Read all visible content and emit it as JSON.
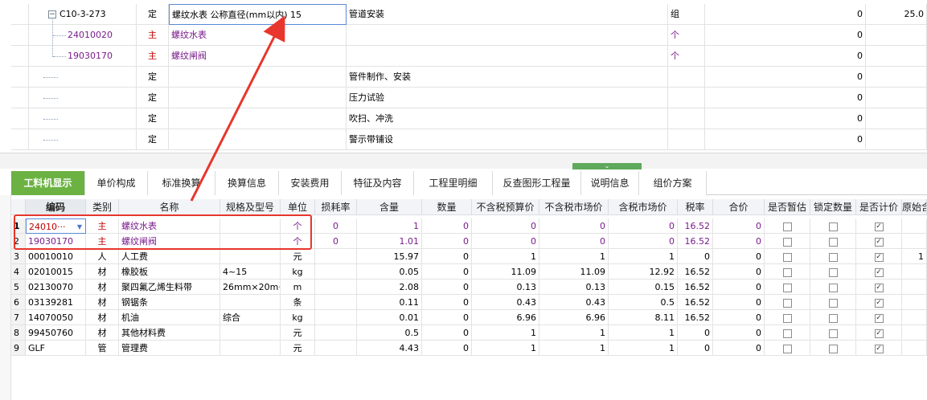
{
  "upper": {
    "rows": [
      {
        "code": "C10-3-273",
        "type": "定",
        "name": "螺纹水表 公称直径(mm以内) 15",
        "desc": "管道安装",
        "unit": "组",
        "qty": "0",
        "price": "25.0",
        "expand": "−"
      },
      {
        "code": "24010020",
        "type": "主",
        "name": "螺纹水表",
        "desc": "",
        "unit": "个",
        "qty": "0",
        "price": ""
      },
      {
        "code": "19030170",
        "type": "主",
        "name": "螺纹闸阀",
        "desc": "",
        "unit": "个",
        "qty": "0",
        "price": ""
      },
      {
        "code": "",
        "type": "定",
        "name": "",
        "desc": "管件制作、安装",
        "unit": "",
        "qty": "0",
        "price": ""
      },
      {
        "code": "",
        "type": "定",
        "name": "",
        "desc": "压力试验",
        "unit": "",
        "qty": "0",
        "price": ""
      },
      {
        "code": "",
        "type": "定",
        "name": "",
        "desc": "吹扫、冲洗",
        "unit": "",
        "qty": "0",
        "price": ""
      },
      {
        "code": "",
        "type": "定",
        "name": "",
        "desc": "警示带铺设",
        "unit": "",
        "qty": "0",
        "price": ""
      }
    ]
  },
  "splitter": {
    "grip": "⌄"
  },
  "tabs": [
    "工料机显示",
    "单价构成",
    "标准换算",
    "换算信息",
    "安装费用",
    "特征及内容",
    "工程里明细",
    "反查图形工程量",
    "说明信息",
    "组价方案"
  ],
  "lower": {
    "headers": [
      "编码",
      "类别",
      "名称",
      "规格及型号",
      "单位",
      "损耗率",
      "含量",
      "数量",
      "不含税预算价",
      "不含税市场价",
      "含税市场价",
      "税率",
      "合价",
      "是否暂估",
      "锁定数量",
      "是否计价",
      "原始含"
    ],
    "rows": [
      {
        "no": "1",
        "code": "24010···",
        "cat": "主",
        "name": "螺纹水表",
        "spec": "",
        "unit": "个",
        "loss": "0",
        "content": "1",
        "num": "0",
        "bp": "0",
        "mp": "0",
        "tmp": "0",
        "tax": "16.52",
        "total": "0",
        "est": false,
        "lock": false,
        "priced": true,
        "orig": ""
      },
      {
        "no": "2",
        "code": "19030170",
        "cat": "主",
        "name": "螺纹闸阀",
        "spec": "",
        "unit": "个",
        "loss": "0",
        "content": "1.01",
        "num": "0",
        "bp": "0",
        "mp": "0",
        "tmp": "0",
        "tax": "16.52",
        "total": "0",
        "est": false,
        "lock": false,
        "priced": true,
        "orig": ""
      },
      {
        "no": "3",
        "code": "00010010",
        "cat": "人",
        "name": "人工费",
        "spec": "",
        "unit": "元",
        "loss": "",
        "content": "15.97",
        "num": "0",
        "bp": "1",
        "mp": "1",
        "tmp": "1",
        "tax": "0",
        "total": "0",
        "est": false,
        "lock": false,
        "priced": true,
        "orig": "1"
      },
      {
        "no": "4",
        "code": "02010015",
        "cat": "材",
        "name": "橡胶板",
        "spec": "4~15",
        "unit": "kg",
        "loss": "",
        "content": "0.05",
        "num": "0",
        "bp": "11.09",
        "mp": "11.09",
        "tmp": "12.92",
        "tax": "16.52",
        "total": "0",
        "est": false,
        "lock": false,
        "priced": true,
        "orig": ""
      },
      {
        "no": "5",
        "code": "02130070",
        "cat": "材",
        "name": "聚四氟乙烯生料带",
        "spec": "26mm×20m···",
        "unit": "m",
        "loss": "",
        "content": "2.08",
        "num": "0",
        "bp": "0.13",
        "mp": "0.13",
        "tmp": "0.15",
        "tax": "16.52",
        "total": "0",
        "est": false,
        "lock": false,
        "priced": true,
        "orig": ""
      },
      {
        "no": "6",
        "code": "03139281",
        "cat": "材",
        "name": "钢锯条",
        "spec": "",
        "unit": "条",
        "loss": "",
        "content": "0.11",
        "num": "0",
        "bp": "0.43",
        "mp": "0.43",
        "tmp": "0.5",
        "tax": "16.52",
        "total": "0",
        "est": false,
        "lock": false,
        "priced": true,
        "orig": ""
      },
      {
        "no": "7",
        "code": "14070050",
        "cat": "材",
        "name": "机油",
        "spec": "综合",
        "unit": "kg",
        "loss": "",
        "content": "0.01",
        "num": "0",
        "bp": "6.96",
        "mp": "6.96",
        "tmp": "8.11",
        "tax": "16.52",
        "total": "0",
        "est": false,
        "lock": false,
        "priced": true,
        "orig": ""
      },
      {
        "no": "8",
        "code": "99450760",
        "cat": "材",
        "name": "其他材料费",
        "spec": "",
        "unit": "元",
        "loss": "",
        "content": "0.5",
        "num": "0",
        "bp": "1",
        "mp": "1",
        "tmp": "1",
        "tax": "0",
        "total": "0",
        "est": false,
        "lock": false,
        "priced": true,
        "orig": ""
      },
      {
        "no": "9",
        "code": "GLF",
        "cat": "管",
        "name": "管理费",
        "spec": "",
        "unit": "元",
        "loss": "",
        "content": "4.43",
        "num": "0",
        "bp": "1",
        "mp": "1",
        "tmp": "1",
        "tax": "0",
        "total": "0",
        "est": false,
        "lock": false,
        "priced": true,
        "orig": ""
      }
    ]
  },
  "colors": {
    "accent": "#6cb243",
    "annotation": "#e8362c",
    "purple": "#7a1b8c",
    "red": "#c00000"
  },
  "icons": {
    "dropdown": "dropdown-arrow-icon",
    "check": "checkbox-checked-icon"
  }
}
